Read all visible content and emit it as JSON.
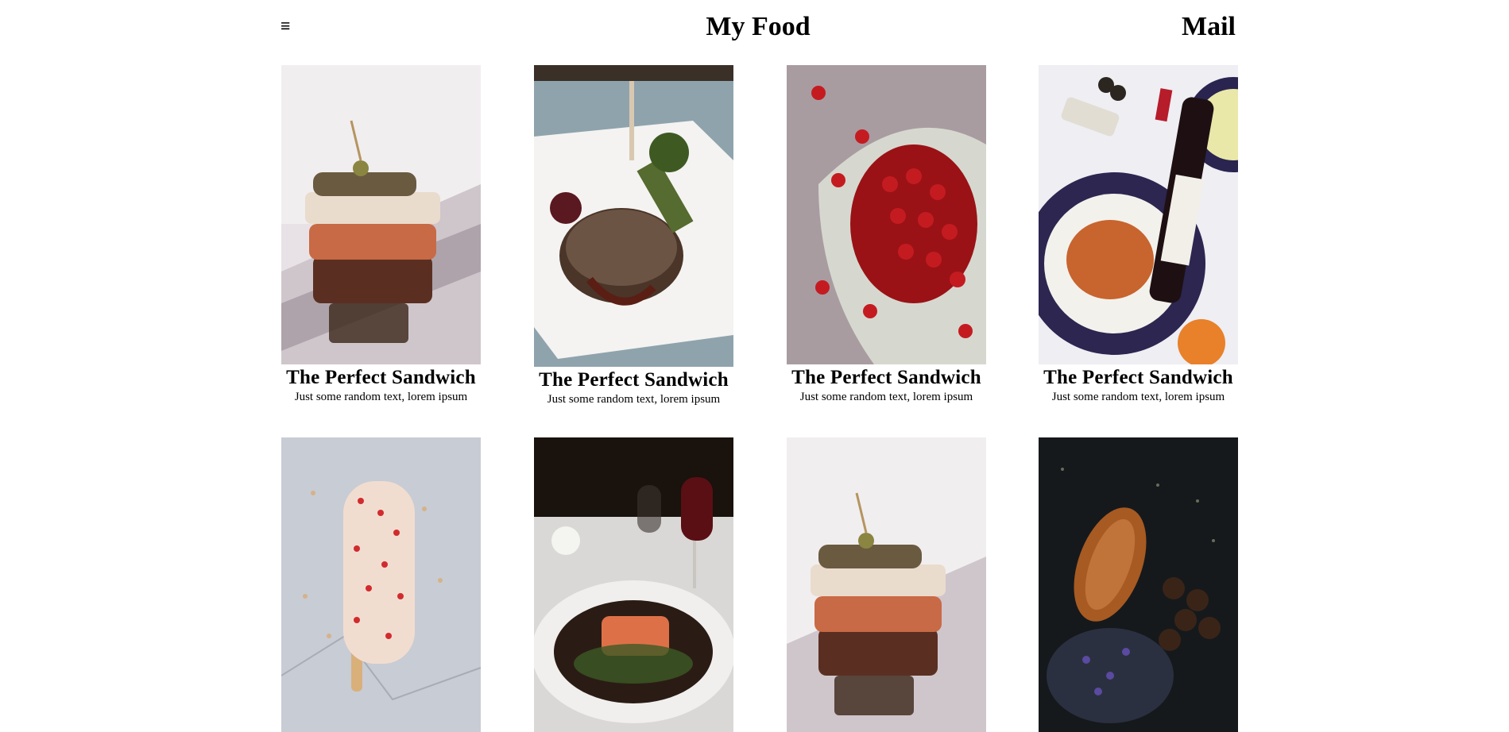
{
  "header": {
    "menu_icon": "hamburger-icon",
    "menu_glyph": "≡",
    "title": "My Food",
    "mail": "Mail"
  },
  "cards": [
    {
      "title": "The Perfect Sandwich",
      "text": "Just some random text, lorem ipsum",
      "image": "sandwich-photo"
    },
    {
      "title": "The Perfect Sandwich",
      "text": "Just some random text, lorem ipsum",
      "image": "steak-photo"
    },
    {
      "title": "The Perfect Sandwich",
      "text": "Just some random text, lorem ipsum",
      "image": "cherries-photo"
    },
    {
      "title": "The Perfect Sandwich",
      "text": "Just some random text, lorem ipsum",
      "image": "wine-pasta-photo"
    },
    {
      "image": "popsicle-photo"
    },
    {
      "image": "salmon-photo"
    },
    {
      "image": "sandwich-photo"
    },
    {
      "image": "croissant-photo"
    }
  ]
}
